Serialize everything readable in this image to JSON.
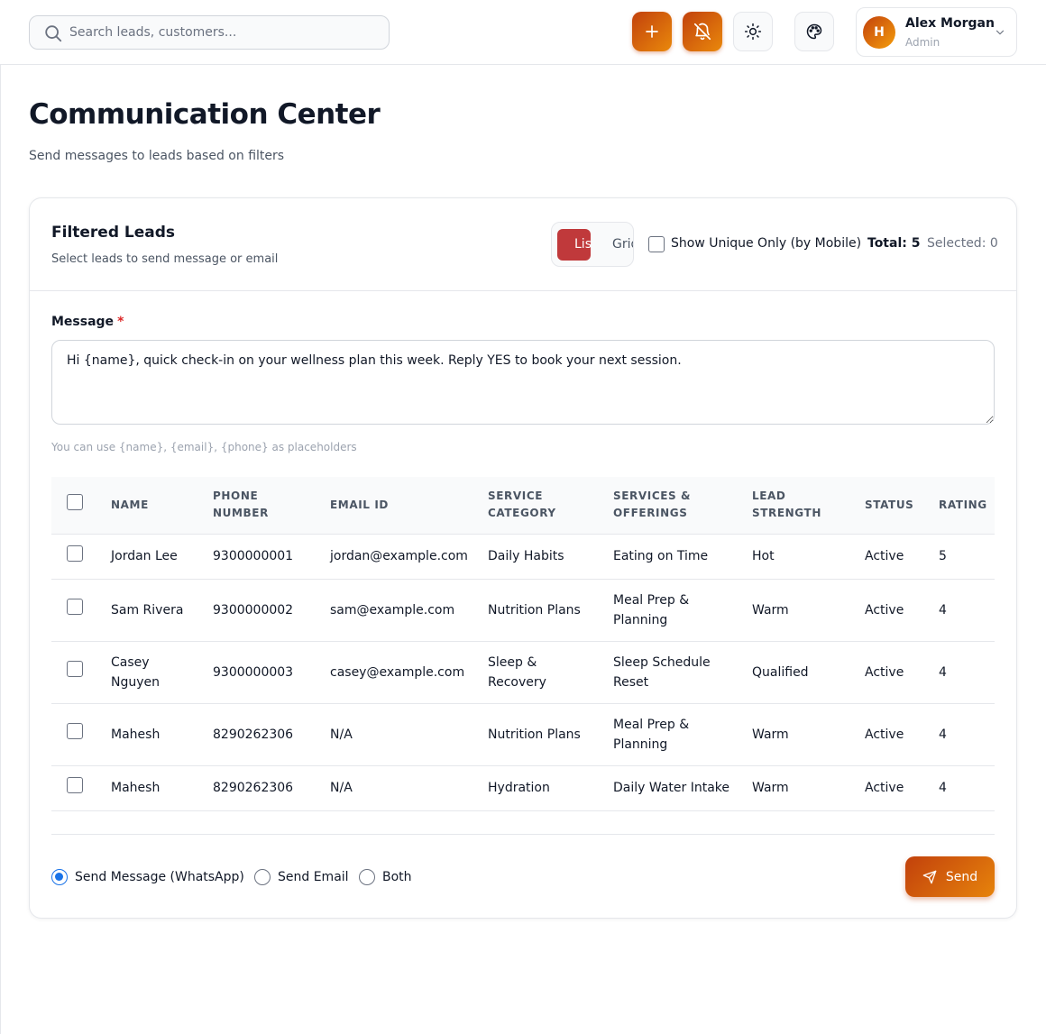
{
  "search": {
    "placeholder": "Search leads, customers..."
  },
  "user": {
    "initial": "H",
    "name": "Alex Morgan",
    "role": "Admin"
  },
  "page": {
    "title": "Communication Center",
    "subtitle": "Send messages to leads based on filters"
  },
  "card": {
    "title": "Filtered Leads",
    "subtitle": "Select leads to send message or email",
    "view_list_label": "List",
    "view_grid_label": "Grid",
    "unique_label": "Show Unique Only (by Mobile)",
    "total_label": "Total: 5",
    "selected_label": "Selected: 0"
  },
  "message": {
    "label": "Message",
    "required_mark": "*",
    "value": "Hi {name}, quick check-in on your wellness plan this week. Reply YES to book your next session.",
    "help": "You can use {name}, {email}, {phone} as placeholders"
  },
  "table": {
    "columns": [
      "NAME",
      "PHONE NUMBER",
      "EMAIL ID",
      "SERVICE CATEGORY",
      "SERVICES & OFFERINGS",
      "LEAD STRENGTH",
      "STATUS",
      "RATING"
    ],
    "rows": [
      {
        "name": "Jordan Lee",
        "phone": "9300000001",
        "email": "jordan@example.com",
        "category": "Daily Habits",
        "service": "Eating on Time",
        "strength": "Hot",
        "status": "Active",
        "rating": "5"
      },
      {
        "name": "Sam Rivera",
        "phone": "9300000002",
        "email": "sam@example.com",
        "category": "Nutrition Plans",
        "service": "Meal Prep & Planning",
        "strength": "Warm",
        "status": "Active",
        "rating": "4"
      },
      {
        "name": "Casey Nguyen",
        "phone": "9300000003",
        "email": "casey@example.com",
        "category": "Sleep & Recovery",
        "service": "Sleep Schedule Reset",
        "strength": "Qualified",
        "status": "Active",
        "rating": "4"
      },
      {
        "name": "Mahesh",
        "phone": "8290262306",
        "email": "N/A",
        "category": "Nutrition Plans",
        "service": "Meal Prep & Planning",
        "strength": "Warm",
        "status": "Active",
        "rating": "4"
      },
      {
        "name": "Mahesh",
        "phone": "8290262306",
        "email": "N/A",
        "category": "Hydration",
        "service": "Daily Water Intake",
        "strength": "Warm",
        "status": "Active",
        "rating": "4"
      }
    ]
  },
  "send": {
    "options": [
      "Send Message (WhatsApp)",
      "Send Email",
      "Both"
    ],
    "selected": "Send Message (WhatsApp)",
    "button_label": "Send"
  },
  "colors": {
    "accent": "#c2410c",
    "accent_light": "#f59e0b",
    "toggle_active": "#c0393b",
    "radio": "#1a73e8"
  },
  "icons": [
    "search-icon",
    "plus-icon",
    "bell-off-icon",
    "sun-icon",
    "palette-icon",
    "chevron-down-icon",
    "send-icon"
  ]
}
